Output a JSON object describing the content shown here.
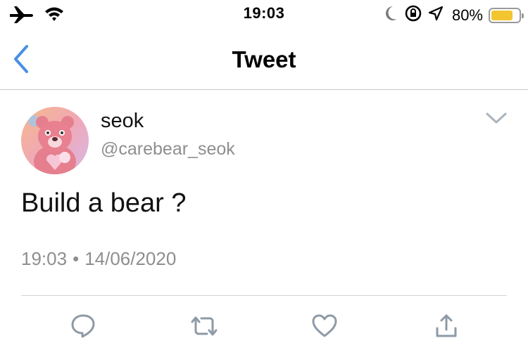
{
  "status_bar": {
    "time": "19:03",
    "battery_percent": "80%",
    "battery_level": 0.8,
    "battery_color": "#f2c531",
    "icons": [
      "airplane-icon",
      "wifi-icon",
      "moon-icon",
      "rotation-lock-icon",
      "location-icon",
      "battery-icon"
    ]
  },
  "nav": {
    "title": "Tweet",
    "back_icon": "chevron-left-icon",
    "accent_color": "#4a90e2"
  },
  "tweet": {
    "display_name": "seok",
    "handle": "@carebear_seok",
    "text": "Build a bear ?",
    "time": "19:03",
    "separator": "•",
    "date": "14/06/2020",
    "menu_icon": "chevron-down-icon"
  },
  "actions": {
    "icons": [
      "reply-icon",
      "retweet-icon",
      "like-icon",
      "share-icon"
    ],
    "icon_color": "#8e9aa6"
  }
}
